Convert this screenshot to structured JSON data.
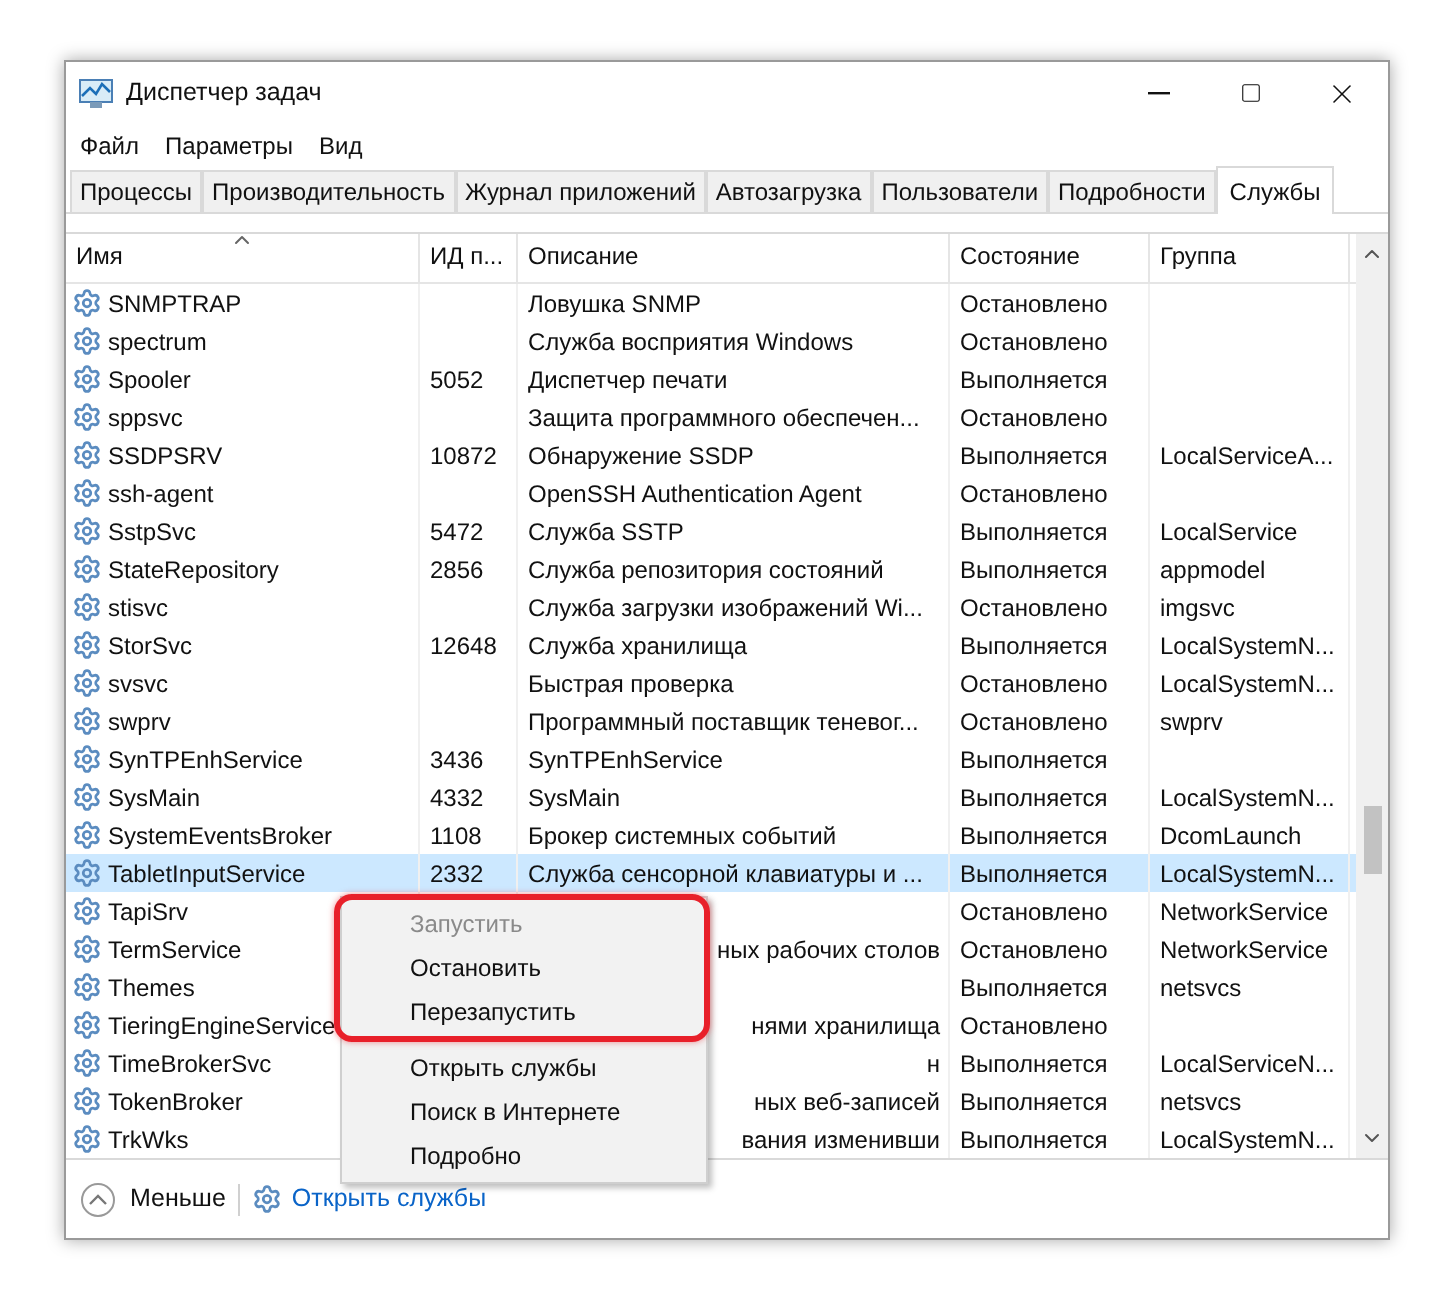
{
  "window": {
    "title": "Диспетчер задач"
  },
  "menu_bar": [
    "Файл",
    "Параметры",
    "Вид"
  ],
  "tabs": [
    {
      "label": "Процессы",
      "selected": false
    },
    {
      "label": "Производительность",
      "selected": false
    },
    {
      "label": "Журнал приложений",
      "selected": false
    },
    {
      "label": "Автозагрузка",
      "selected": false
    },
    {
      "label": "Пользователи",
      "selected": false
    },
    {
      "label": "Подробности",
      "selected": false
    },
    {
      "label": "Службы",
      "selected": true
    }
  ],
  "table": {
    "columns": [
      {
        "label": "Имя",
        "sorted": true
      },
      {
        "label": "ИД п...",
        "sorted": false
      },
      {
        "label": "Описание",
        "sorted": false
      },
      {
        "label": "Состояние",
        "sorted": false
      },
      {
        "label": "Группа",
        "sorted": false
      }
    ],
    "rows": [
      {
        "name": "SNMPTRAP",
        "pid": "",
        "description": "Ловушка SNMP",
        "status": "Остановлено",
        "group": "",
        "selected": false
      },
      {
        "name": "spectrum",
        "pid": "",
        "description": "Служба восприятия Windows",
        "status": "Остановлено",
        "group": "",
        "selected": false
      },
      {
        "name": "Spooler",
        "pid": "5052",
        "description": "Диспетчер печати",
        "status": "Выполняется",
        "group": "",
        "selected": false
      },
      {
        "name": "sppsvc",
        "pid": "",
        "description": "Защита программного обеспечен...",
        "status": "Остановлено",
        "group": "",
        "selected": false
      },
      {
        "name": "SSDPSRV",
        "pid": "10872",
        "description": "Обнаружение SSDP",
        "status": "Выполняется",
        "group": "LocalServiceA...",
        "selected": false
      },
      {
        "name": "ssh-agent",
        "pid": "",
        "description": "OpenSSH Authentication Agent",
        "status": "Остановлено",
        "group": "",
        "selected": false
      },
      {
        "name": "SstpSvc",
        "pid": "5472",
        "description": "Служба SSTP",
        "status": "Выполняется",
        "group": "LocalService",
        "selected": false
      },
      {
        "name": "StateRepository",
        "pid": "2856",
        "description": "Служба репозитория состояний",
        "status": "Выполняется",
        "group": "appmodel",
        "selected": false
      },
      {
        "name": "stisvc",
        "pid": "",
        "description": "Служба загрузки изображений Wi...",
        "status": "Остановлено",
        "group": "imgsvc",
        "selected": false
      },
      {
        "name": "StorSvc",
        "pid": "12648",
        "description": "Служба хранилища",
        "status": "Выполняется",
        "group": "LocalSystemN...",
        "selected": false
      },
      {
        "name": "svsvc",
        "pid": "",
        "description": "Быстрая проверка",
        "status": "Остановлено",
        "group": "LocalSystemN...",
        "selected": false
      },
      {
        "name": "swprv",
        "pid": "",
        "description": "Программный поставщик теневог...",
        "status": "Остановлено",
        "group": "swprv",
        "selected": false
      },
      {
        "name": "SynTPEnhService",
        "pid": "3436",
        "description": "SynTPEnhService",
        "status": "Выполняется",
        "group": "",
        "selected": false
      },
      {
        "name": "SysMain",
        "pid": "4332",
        "description": "SysMain",
        "status": "Выполняется",
        "group": "LocalSystemN...",
        "selected": false
      },
      {
        "name": "SystemEventsBroker",
        "pid": "1108",
        "description": "Брокер системных событий",
        "status": "Выполняется",
        "group": "DcomLaunch",
        "selected": false
      },
      {
        "name": "TabletInputService",
        "pid": "2332",
        "description": "Служба сенсорной клавиатуры и ...",
        "status": "Выполняется",
        "group": "LocalSystemN...",
        "selected": true
      },
      {
        "name": "TapiSrv",
        "pid": "",
        "description": "",
        "status": "Остановлено",
        "group": "NetworkService",
        "selected": false
      },
      {
        "name": "TermService",
        "pid": "",
        "description": "ных рабочих столов",
        "status": "Остановлено",
        "group": "NetworkService",
        "selected": false
      },
      {
        "name": "Themes",
        "pid": "",
        "description": "",
        "status": "Выполняется",
        "group": "netsvcs",
        "selected": false
      },
      {
        "name": "TieringEngineService",
        "pid": "",
        "description": "нями хранилища",
        "status": "Остановлено",
        "group": "",
        "selected": false
      },
      {
        "name": "TimeBrokerSvc",
        "pid": "",
        "description": "н",
        "status": "Выполняется",
        "group": "LocalServiceN...",
        "selected": false
      },
      {
        "name": "TokenBroker",
        "pid": "",
        "description": "ных веб-записей",
        "status": "Выполняется",
        "group": "netsvcs",
        "selected": false
      },
      {
        "name": "TrkWks",
        "pid": "",
        "description": "вания изменивши",
        "status": "Выполняется",
        "group": "LocalSystemN...",
        "selected": false
      }
    ]
  },
  "context_menu": {
    "groups": [
      {
        "highlighted": true,
        "items": [
          {
            "label": "Запустить",
            "disabled": true
          },
          {
            "label": "Остановить",
            "disabled": false
          },
          {
            "label": "Перезапустить",
            "disabled": false
          }
        ]
      },
      {
        "highlighted": false,
        "items": [
          {
            "label": "Открыть службы",
            "disabled": false
          },
          {
            "label": "Поиск в Интернете",
            "disabled": false
          },
          {
            "label": "Подробно",
            "disabled": false
          }
        ]
      }
    ]
  },
  "footer": {
    "less": "Меньше",
    "open_services": "Открыть службы"
  }
}
